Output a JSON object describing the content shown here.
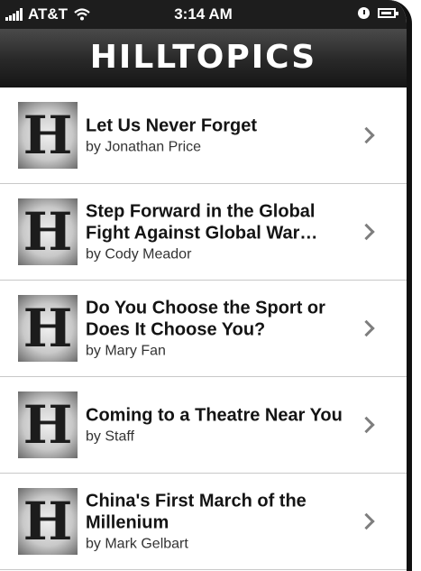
{
  "status_bar": {
    "carrier": "AT&T",
    "time": "3:14 AM"
  },
  "nav": {
    "title": "HILLTOPICS"
  },
  "thumbnail_letter": "H",
  "articles": [
    {
      "title": "Let Us Never Forget",
      "byline": "by Jonathan Price"
    },
    {
      "title": "Step Forward in the Global Fight Against Global War…",
      "byline": "by Cody Meador"
    },
    {
      "title": "Do You Choose the Sport or Does It Choose You?",
      "byline": "by Mary Fan"
    },
    {
      "title": "Coming to a Theatre Near You",
      "byline": "by Staff"
    },
    {
      "title": "China's First March of the Millenium",
      "byline": "by Mark Gelbart"
    }
  ]
}
